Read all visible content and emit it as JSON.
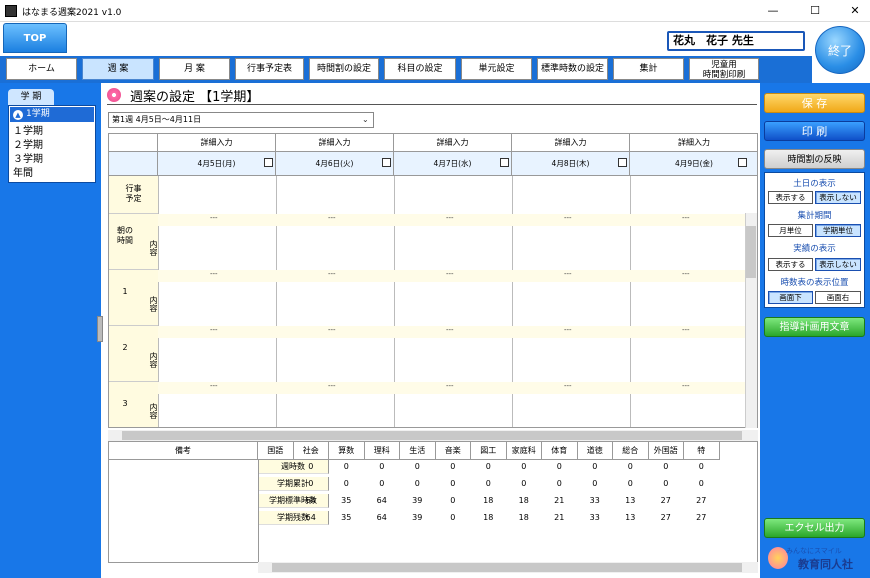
{
  "app": {
    "title": "はなまる週案2021 v1.0",
    "icon_text": "週案"
  },
  "window_controls": {
    "minimize": "—",
    "maximize": "☐",
    "close": "✕"
  },
  "top_tab": "TOP",
  "user": {
    "name": "花丸　花子 先生"
  },
  "exit_label": "終了",
  "nav": [
    {
      "label": "ホーム"
    },
    {
      "label": "週 案"
    },
    {
      "label": "月 案"
    },
    {
      "label": "行事予定表"
    },
    {
      "label": "時間割の設定"
    },
    {
      "label": "科目の設定"
    },
    {
      "label": "単元設定"
    },
    {
      "label": "標準時数の設定"
    },
    {
      "label": "集計"
    },
    {
      "label": "児童用",
      "label2": "時間割印刷"
    }
  ],
  "term": {
    "tab_label": "学 期",
    "selected": "1学期",
    "items": [
      "１学期",
      "２学期",
      "３学期",
      "年間"
    ]
  },
  "page": {
    "title": "週案の設定 【1学期】",
    "week_select": "第1週 4月5日～4月11日"
  },
  "grid": {
    "detail_label": "詳細入力",
    "days": [
      "4月5日(月)",
      "4月6日(火)",
      "4月7日(水)",
      "4月8日(木)",
      "4月9日(金)"
    ],
    "events_label_1": "行事",
    "events_label_2": "予定",
    "dash": "---",
    "periods": [
      {
        "label": "朝の\n時間",
        "sub": "内容"
      },
      {
        "label": "1",
        "sub": "内容"
      },
      {
        "label": "2",
        "sub": "内容"
      },
      {
        "label": "3",
        "sub": "内容"
      }
    ]
  },
  "summary": {
    "remarks_label": "備考",
    "subjects": [
      "国語",
      "社会",
      "算数",
      "理科",
      "生活",
      "音楽",
      "図工",
      "家庭科",
      "体育",
      "道徳",
      "総合",
      "外国語",
      "特"
    ],
    "rows": [
      {
        "label": "週時数",
        "values": [
          "0",
          "0",
          "0",
          "0",
          "0",
          "0",
          "0",
          "0",
          "0",
          "0",
          "0",
          "0"
        ]
      },
      {
        "label": "学期累計",
        "values": [
          "0",
          "0",
          "0",
          "0",
          "0",
          "0",
          "0",
          "0",
          "0",
          "0",
          "0",
          "0"
        ]
      },
      {
        "label": "学期標準時数",
        "values": [
          "64",
          "35",
          "64",
          "39",
          "0",
          "18",
          "18",
          "21",
          "33",
          "13",
          "27",
          "27"
        ]
      },
      {
        "label": "学期残数",
        "values": [
          "64",
          "35",
          "64",
          "39",
          "0",
          "18",
          "18",
          "21",
          "33",
          "13",
          "27",
          "27"
        ]
      }
    ]
  },
  "right_panel": {
    "save": "保 存",
    "print": "印 刷",
    "reflect": "時間割の反映",
    "weekend_label": "土日の表示",
    "show": "表示する",
    "hide": "表示しない",
    "period_label": "集計期間",
    "monthly": "月単位",
    "termly": "学期単位",
    "actual_label": "実績の表示",
    "show2": "表示する",
    "hide2": "表示しない",
    "table_pos_label": "時数表の表示位置",
    "bottom": "画面下",
    "right": "画面右",
    "guide": "指導計画用文章",
    "excel": "エクセル出力"
  },
  "logo": {
    "tagline": "みんなにスマイル",
    "name": "教育同人社"
  }
}
